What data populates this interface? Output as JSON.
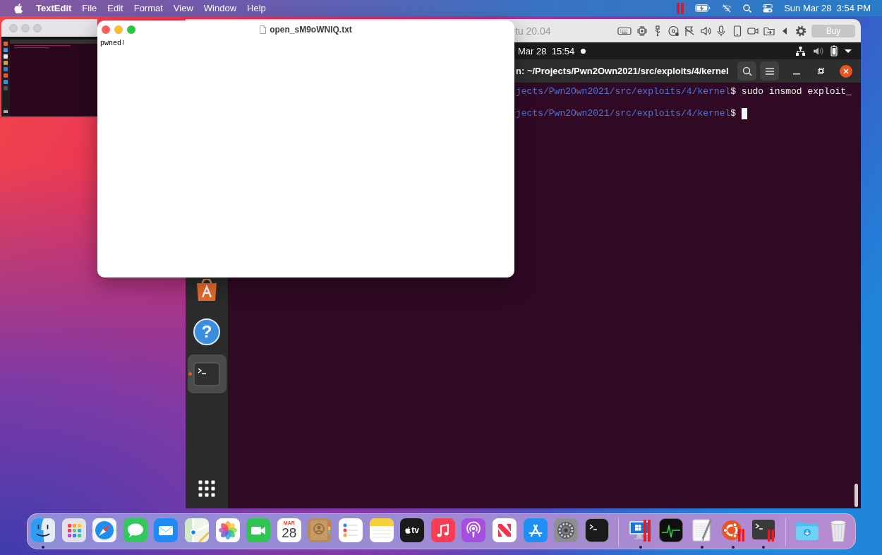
{
  "menu_bar": {
    "app_name": "TextEdit",
    "menus": [
      "File",
      "Edit",
      "Format",
      "View",
      "Window",
      "Help"
    ],
    "clock": "Sun Mar 28  3:54 PM"
  },
  "vm_window": {
    "title": "tu 20.04",
    "buy_button": "Buy"
  },
  "ubuntu_top_bar": {
    "clock": "Mar 28  15:54"
  },
  "ubuntu_dock": {
    "items": [
      {
        "kind": "software",
        "running": false,
        "selected": false
      },
      {
        "kind": "help",
        "label": "?",
        "running": false,
        "selected": false
      },
      {
        "kind": "terminal",
        "running": true,
        "selected": true
      }
    ]
  },
  "terminal": {
    "title": "n: ~/Projects/Pwn2Own2021/src/exploits/4/kernel",
    "lines": [
      {
        "path": "jects/Pwn2Own2021/src/exploits/4/kernel",
        "command": "$ sudo insmod exploit_",
        "cursor": false
      },
      {
        "path": "jects/Pwn2Own2021/src/exploits/4/kernel",
        "command": "$",
        "cursor": true
      }
    ]
  },
  "textedit_window": {
    "title": "open_sM9oWNIQ.txt",
    "content": "pwned!"
  },
  "dock": {
    "apps": [
      {
        "kind": "finder",
        "running": true
      },
      {
        "kind": "launchpad",
        "running": false
      },
      {
        "kind": "safari",
        "running": false
      },
      {
        "kind": "messages",
        "running": false
      },
      {
        "kind": "mail",
        "running": false
      },
      {
        "kind": "maps",
        "running": false
      },
      {
        "kind": "photos",
        "running": false
      },
      {
        "kind": "facetime",
        "running": false
      },
      {
        "kind": "calendar",
        "month": "MAR",
        "day": "28",
        "running": false
      },
      {
        "kind": "contacts",
        "running": false
      },
      {
        "kind": "reminders",
        "running": false
      },
      {
        "kind": "notes",
        "running": false
      },
      {
        "kind": "tv",
        "label": "tv",
        "running": false
      },
      {
        "kind": "music",
        "running": false
      },
      {
        "kind": "podcasts",
        "running": false
      },
      {
        "kind": "news",
        "running": false
      },
      {
        "kind": "app_store",
        "running": false
      },
      {
        "kind": "system_preferences",
        "running": false
      },
      {
        "kind": "terminal",
        "running": false
      }
    ],
    "recent": [
      {
        "kind": "windows_vm",
        "running": true
      },
      {
        "kind": "activity_monitor",
        "running": false
      },
      {
        "kind": "textedit",
        "running": true
      },
      {
        "kind": "ubuntu_vm",
        "running": true
      },
      {
        "kind": "terminal_vm",
        "running": true
      }
    ],
    "stacks": [
      {
        "kind": "downloads",
        "running": false
      },
      {
        "kind": "trash",
        "running": false
      }
    ]
  }
}
